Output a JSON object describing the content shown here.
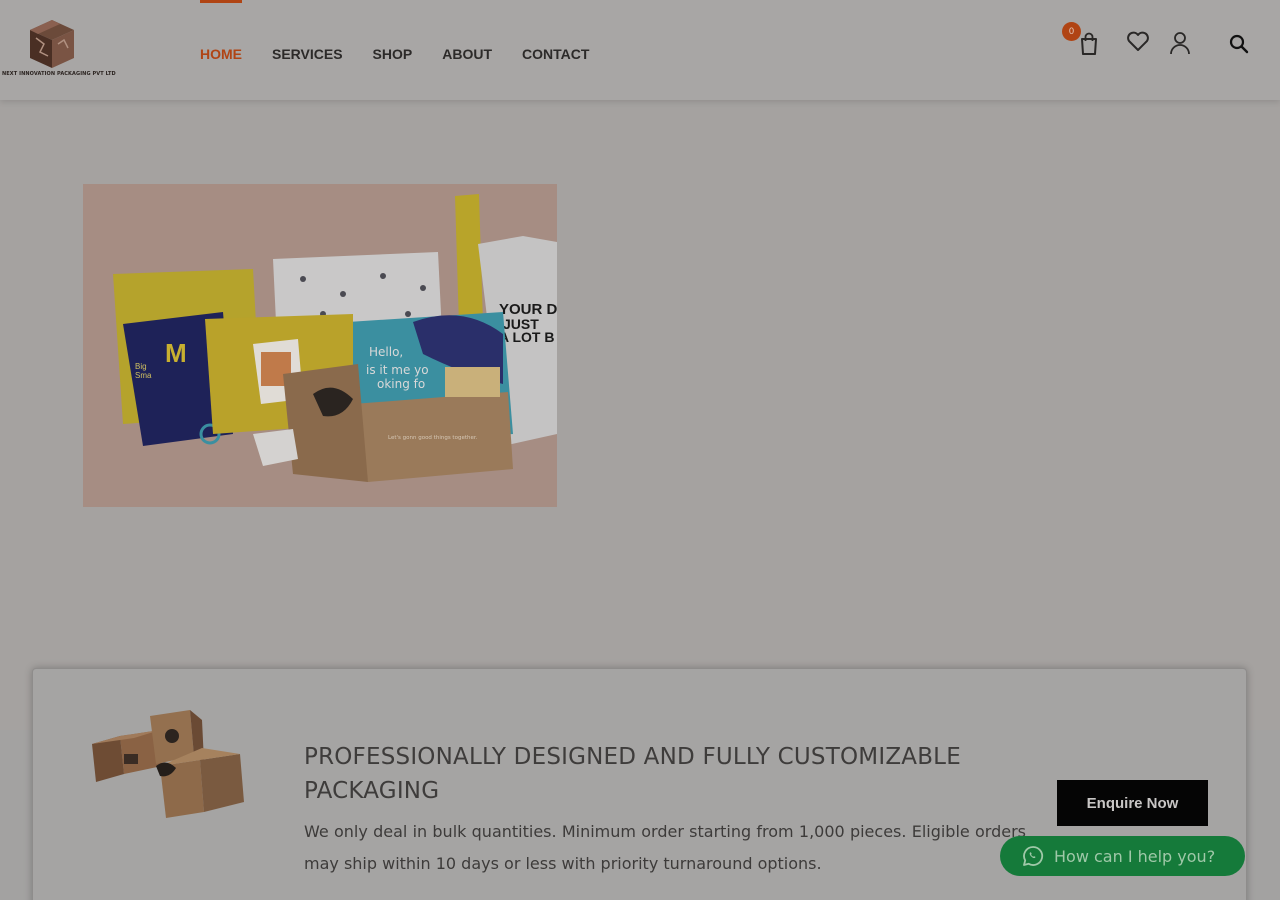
{
  "header": {
    "logo_caption": "NEXT INNOVATION PACKAGING PVT LTD",
    "nav": [
      {
        "label": "HOME",
        "active": true
      },
      {
        "label": "SERVICES",
        "active": false
      },
      {
        "label": "SHOP",
        "active": false
      },
      {
        "label": "ABOUT",
        "active": false
      },
      {
        "label": "CONTACT",
        "active": false
      }
    ],
    "cart_count": "0",
    "icons": [
      "cart-icon",
      "heart-icon",
      "user-icon",
      "search-icon"
    ]
  },
  "hero": {
    "image_text": [
      "YOUR DA",
      "JUST",
      "A LOT B",
      "Hello,",
      "is it me yo",
      "oking fo",
      "Big",
      "Sma",
      "Let's gonn good things together."
    ]
  },
  "card": {
    "title": "PROFESSIONALLY DESIGNED AND FULLY CUSTOMIZABLE PACKAGING",
    "text": "We only deal in bulk quantities. Minimum order starting from 1,000 pieces. Eligible orders may ship within 10 days or less with priority turnaround options.",
    "enquire_label": "Enquire Now"
  },
  "whatsapp": {
    "label": "How can I help you?"
  },
  "colors": {
    "accent": "#b04414",
    "whatsapp": "#157a3a",
    "button_dark": "#050505"
  }
}
